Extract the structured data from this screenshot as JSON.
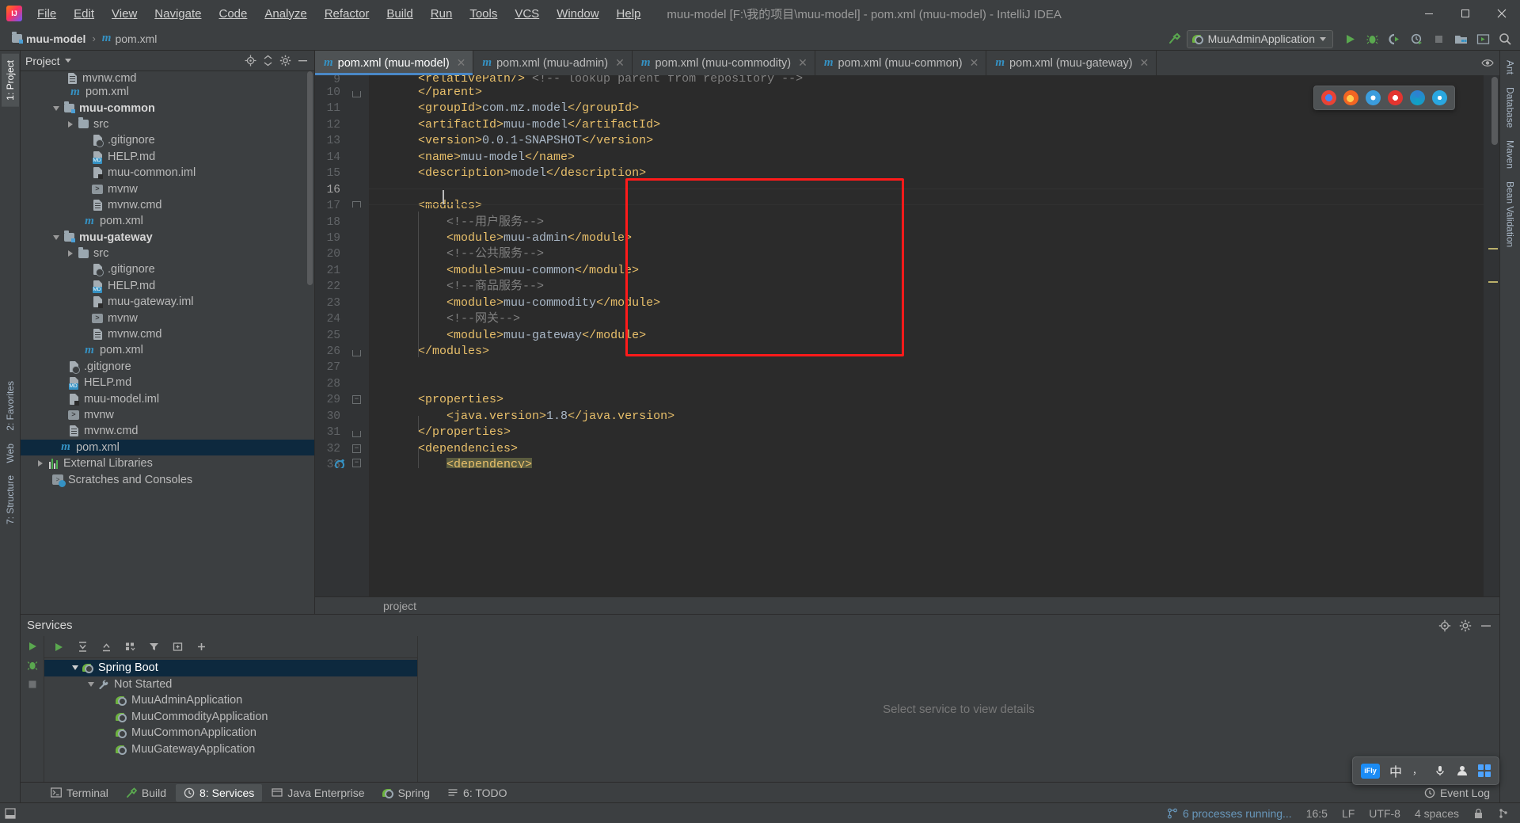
{
  "window": {
    "title": "muu-model [F:\\我的项目\\muu-model] - pom.xml (muu-model) - IntelliJ IDEA",
    "minimize_label": "—",
    "maximize_label": "▢",
    "close_label": "✕"
  },
  "menu": {
    "items": [
      {
        "label": "File"
      },
      {
        "label": "Edit"
      },
      {
        "label": "View"
      },
      {
        "label": "Navigate"
      },
      {
        "label": "Code"
      },
      {
        "label": "Analyze"
      },
      {
        "label": "Refactor"
      },
      {
        "label": "Build"
      },
      {
        "label": "Run"
      },
      {
        "label": "Tools"
      },
      {
        "label": "VCS"
      },
      {
        "label": "Window"
      },
      {
        "label": "Help"
      }
    ]
  },
  "navbar": {
    "breadcrumb": [
      {
        "label": "muu-model",
        "icon": "module-folder-icon"
      },
      {
        "label": "pom.xml",
        "icon": "maven-m-icon"
      }
    ],
    "separator": "›",
    "run_config": {
      "name": "MuuAdminApplication",
      "icon": "spring-boot-icon",
      "dropdown": "▾"
    },
    "buttons": [
      {
        "name": "build-hammer",
        "label": "Build"
      },
      {
        "name": "run",
        "label": "Run"
      },
      {
        "name": "debug",
        "label": "Debug"
      },
      {
        "name": "run-coverage",
        "label": "Run with Coverage"
      },
      {
        "name": "profiler",
        "label": "Profiler"
      },
      {
        "name": "stop",
        "label": "Stop"
      },
      {
        "name": "project-structure",
        "label": "Project Structure"
      },
      {
        "name": "select-target",
        "label": "Select Run Target"
      },
      {
        "name": "search-everywhere",
        "label": "Search Everywhere"
      }
    ]
  },
  "left_strip": {
    "tabs": [
      {
        "label": "1: Project",
        "active": true
      },
      {
        "label": "2: Favorites",
        "active": false
      },
      {
        "label": "Web",
        "active": false
      },
      {
        "label": "7: Structure",
        "active": false
      }
    ]
  },
  "right_strip": {
    "tabs": [
      {
        "label": "Ant"
      },
      {
        "label": "Database"
      },
      {
        "label": "Maven"
      },
      {
        "label": "Bean Validation"
      }
    ]
  },
  "project_panel": {
    "title": "Project",
    "header_icons": [
      "locate-icon",
      "collapse-all-icon",
      "settings-gear-icon",
      "hide-icon"
    ],
    "tree": [
      {
        "depth": 3,
        "label": "mvnw.cmd",
        "icon": "doc-file-icon",
        "arrow": "",
        "bold": false,
        "clipped": true
      },
      {
        "depth": 3,
        "label": "pom.xml",
        "icon": "maven-m-icon",
        "arrow": "",
        "bold": false
      },
      {
        "depth": 1,
        "label": "muu-common",
        "icon": "module-folder-icon",
        "arrow": "down",
        "bold": true
      },
      {
        "depth": 2,
        "label": "src",
        "icon": "folder-icon",
        "arrow": "right",
        "bold": false
      },
      {
        "depth": 3,
        "label": ".gitignore",
        "icon": "gitignore-file-icon",
        "arrow": "",
        "bold": false
      },
      {
        "depth": 3,
        "label": "HELP.md",
        "icon": "markdown-file-icon",
        "arrow": "",
        "bold": false
      },
      {
        "depth": 3,
        "label": "muu-common.iml",
        "icon": "iml-file-icon",
        "arrow": "",
        "bold": false
      },
      {
        "depth": 3,
        "label": "mvnw",
        "icon": "shell-file-icon",
        "arrow": "",
        "bold": false
      },
      {
        "depth": 3,
        "label": "mvnw.cmd",
        "icon": "doc-file-icon",
        "arrow": "",
        "bold": false
      },
      {
        "depth": 3,
        "label": "pom.xml",
        "icon": "maven-m-icon",
        "arrow": "",
        "bold": false
      },
      {
        "depth": 1,
        "label": "muu-gateway",
        "icon": "module-folder-icon",
        "arrow": "down",
        "bold": true
      },
      {
        "depth": 2,
        "label": "src",
        "icon": "folder-icon",
        "arrow": "right",
        "bold": false
      },
      {
        "depth": 3,
        "label": ".gitignore",
        "icon": "gitignore-file-icon",
        "arrow": "",
        "bold": false
      },
      {
        "depth": 3,
        "label": "HELP.md",
        "icon": "markdown-file-icon",
        "arrow": "",
        "bold": false
      },
      {
        "depth": 3,
        "label": "muu-gateway.iml",
        "icon": "iml-file-icon",
        "arrow": "",
        "bold": false
      },
      {
        "depth": 3,
        "label": "mvnw",
        "icon": "shell-file-icon",
        "arrow": "",
        "bold": false
      },
      {
        "depth": 3,
        "label": "mvnw.cmd",
        "icon": "doc-file-icon",
        "arrow": "",
        "bold": false
      },
      {
        "depth": 3,
        "label": "pom.xml",
        "icon": "maven-m-icon",
        "arrow": "",
        "bold": false
      },
      {
        "depth": 2,
        "label": ".gitignore",
        "icon": "gitignore-file-icon",
        "arrow": "",
        "bold": false
      },
      {
        "depth": 2,
        "label": "HELP.md",
        "icon": "markdown-file-icon",
        "arrow": "",
        "bold": false
      },
      {
        "depth": 2,
        "label": "muu-model.iml",
        "icon": "iml-file-icon",
        "arrow": "",
        "bold": false
      },
      {
        "depth": 2,
        "label": "mvnw",
        "icon": "shell-file-icon",
        "arrow": "",
        "bold": false
      },
      {
        "depth": 2,
        "label": "mvnw.cmd",
        "icon": "doc-file-icon",
        "arrow": "",
        "bold": false
      },
      {
        "depth": 2,
        "label": "pom.xml",
        "icon": "maven-m-icon",
        "arrow": "",
        "bold": false,
        "selected": true
      },
      {
        "depth": 0,
        "label": "External Libraries",
        "icon": "libraries-icon",
        "arrow": "right",
        "bold": false
      },
      {
        "depth": 0,
        "label": "Scratches and Consoles",
        "icon": "scratches-icon",
        "arrow": "",
        "bold": false
      }
    ]
  },
  "editor": {
    "tabs": [
      {
        "label": "pom.xml (muu-model)",
        "icon": "maven-m-icon",
        "active": true,
        "close": "✕"
      },
      {
        "label": "pom.xml (muu-admin)",
        "icon": "maven-m-icon",
        "active": false,
        "close": "✕"
      },
      {
        "label": "pom.xml (muu-commodity)",
        "icon": "maven-m-icon",
        "active": false,
        "close": "✕"
      },
      {
        "label": "pom.xml (muu-common)",
        "icon": "maven-m-icon",
        "active": false,
        "close": "✕"
      },
      {
        "label": "pom.xml (muu-gateway)",
        "icon": "maven-m-icon",
        "active": false,
        "close": "✕"
      }
    ],
    "breadcrumb_status": "project",
    "lines": [
      {
        "n": 9,
        "text": "        <relativePath/> <!-- lookup parent from repository -->",
        "clipped": true
      },
      {
        "n": 10,
        "text": "    </parent>"
      },
      {
        "n": 11,
        "text": "    <groupId>com.mz.model</groupId>"
      },
      {
        "n": 12,
        "text": "    <artifactId>muu-model</artifactId>"
      },
      {
        "n": 13,
        "text": "    <version>0.0.1-SNAPSHOT</version>"
      },
      {
        "n": 14,
        "text": "    <name>muu-model</name>"
      },
      {
        "n": 15,
        "text": "    <description>model</description>"
      },
      {
        "n": 16,
        "text": ""
      },
      {
        "n": 17,
        "text": "    <modules>"
      },
      {
        "n": 18,
        "text": "        <!--用户服务-->"
      },
      {
        "n": 19,
        "text": "        <module>muu-admin</module>"
      },
      {
        "n": 20,
        "text": "        <!--公共服务-->"
      },
      {
        "n": 21,
        "text": "        <module>muu-common</module>"
      },
      {
        "n": 22,
        "text": "        <!--商品服务-->"
      },
      {
        "n": 23,
        "text": "        <module>muu-commodity</module>"
      },
      {
        "n": 24,
        "text": "        <!--网关-->"
      },
      {
        "n": 25,
        "text": "        <module>muu-gateway</module>"
      },
      {
        "n": 26,
        "text": "    </modules>"
      },
      {
        "n": 27,
        "text": ""
      },
      {
        "n": 28,
        "text": ""
      },
      {
        "n": 29,
        "text": "    <properties>"
      },
      {
        "n": 30,
        "text": "        <java.version>1.8</java.version>"
      },
      {
        "n": 31,
        "text": "    </properties>"
      },
      {
        "n": 32,
        "text": "    <dependencies>"
      },
      {
        "n": 33,
        "text": "        <dependency>",
        "highlight": true
      }
    ]
  },
  "services": {
    "title": "Services",
    "header_icons": [
      "locate-icon",
      "settings-gear-icon",
      "hide-icon"
    ],
    "side_buttons": [
      "run-icon",
      "debug-icon",
      "stop-icon"
    ],
    "toolbar_icons": [
      "run-icon",
      "expand-all-icon",
      "collapse-all-icon",
      "group-icon",
      "filter-icon",
      "add-tab-icon",
      "add-icon"
    ],
    "tree": [
      {
        "depth": 0,
        "label": "Spring Boot",
        "icon": "spring-boot-icon",
        "arrow": "down",
        "selected": true
      },
      {
        "depth": 1,
        "label": "Not Started",
        "icon": "wrench-icon",
        "arrow": "down",
        "selected": false
      },
      {
        "depth": 2,
        "label": "MuuAdminApplication",
        "icon": "spring-boot-icon",
        "arrow": "",
        "selected": false
      },
      {
        "depth": 2,
        "label": "MuuCommodityApplication",
        "icon": "spring-boot-icon",
        "arrow": "",
        "selected": false
      },
      {
        "depth": 2,
        "label": "MuuCommonApplication",
        "icon": "spring-boot-icon",
        "arrow": "",
        "selected": false
      },
      {
        "depth": 2,
        "label": "MuuGatewayApplication",
        "icon": "spring-boot-icon",
        "arrow": "",
        "selected": false
      }
    ],
    "empty_detail": "Select service to view details"
  },
  "bottom_tabs": [
    {
      "label": "Terminal",
      "icon": "terminal-icon",
      "active": false
    },
    {
      "label": "Build",
      "icon": "build-icon",
      "active": false
    },
    {
      "label": "8: Services",
      "icon": "services-icon",
      "active": true
    },
    {
      "label": "Java Enterprise",
      "icon": "java-ee-icon",
      "active": false
    },
    {
      "label": "Spring",
      "icon": "spring-icon",
      "active": false
    },
    {
      "label": "6: TODO",
      "icon": "todo-icon",
      "active": false
    }
  ],
  "event_log": {
    "label": "Event Log",
    "icon": "event-log-icon"
  },
  "statusbar": {
    "processes": "6 processes running...",
    "time": "16:5",
    "line_sep": "LF",
    "encoding": "UTF-8",
    "indent": "4 spaces",
    "lock_icon": "lock-icon",
    "branch_icon": "branch-icon"
  },
  "browser_popup": {
    "icons": [
      "chrome-icon",
      "firefox-icon",
      "safari-icon",
      "opera-icon",
      "edge-icon",
      "ie-icon"
    ],
    "colors": [
      "#e8503a",
      "#f0862a",
      "#3b9ddd",
      "#e3342f",
      "#2f7fd1",
      "#2aa7e0"
    ]
  },
  "ime_bar": {
    "logo": "iFly",
    "mode": "中",
    "icons": [
      "punctuation-icon",
      "microphone-icon",
      "user-icon",
      "apps-icon"
    ]
  },
  "colors": {
    "accent": "#4a88c7",
    "selection": "#0d293e",
    "redbox": "#ff1a1a",
    "tag": "#e8bf6a",
    "value": "#a9b7c6",
    "comment": "#808080",
    "spring_green": "#6db33f"
  }
}
